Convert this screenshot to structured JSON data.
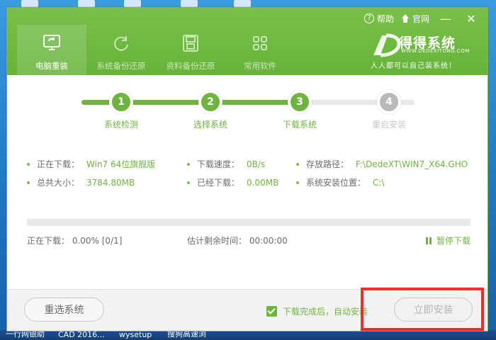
{
  "window": {
    "top_actions": {
      "help": "帮助",
      "site": "官网"
    },
    "nav": [
      {
        "label": "电脑重装",
        "icon": "monitor-refresh-icon",
        "active": true
      },
      {
        "label": "系统备份还原",
        "icon": "refresh-icon",
        "active": false
      },
      {
        "label": "资料备份还原",
        "icon": "disk-icon",
        "active": false
      },
      {
        "label": "常用软件",
        "icon": "apps-grid-icon",
        "active": false
      }
    ],
    "brand": {
      "title": "得得系统",
      "subtitle": "WWW.DEDEXITONG.COM",
      "slogan": "人人都可以自己装系统！"
    }
  },
  "steps": [
    {
      "num": "1",
      "label": "系统检测",
      "state": "done"
    },
    {
      "num": "2",
      "label": "选择系统",
      "state": "done"
    },
    {
      "num": "3",
      "label": "下载系统",
      "state": "done"
    },
    {
      "num": "4",
      "label": "重启安装",
      "state": "todo"
    }
  ],
  "download": {
    "downloading_label": "正在下载：",
    "downloading_value": "Win7 64位旗舰版",
    "speed_label": "下载速度：",
    "speed_value": "0B/s",
    "path_label": "存放路径：",
    "path_value": "F:\\DedeXT\\WIN7_X64.GHO",
    "total_label": "总共大小：",
    "total_value": "3784.80MB",
    "downloaded_label": "已经下载：",
    "downloaded_value": "0.00MB",
    "install_loc_label": "系统安装位置：",
    "install_loc_value": "C:\\"
  },
  "progress": {
    "fraction": 0.0,
    "left_text": "正在下载：  0.00%   [0/1]",
    "mid_text": "估计剩余时间：  00:00:00",
    "pause": "暂停下载"
  },
  "footer": {
    "reselect": "重选系统",
    "auto_install": "下载完成后，自动安装",
    "install_now": "立即安装"
  },
  "taskbar": {
    "items": [
      "一行网银助",
      "CAD 2016...",
      "wysetup",
      "搜狗高速浏"
    ]
  }
}
